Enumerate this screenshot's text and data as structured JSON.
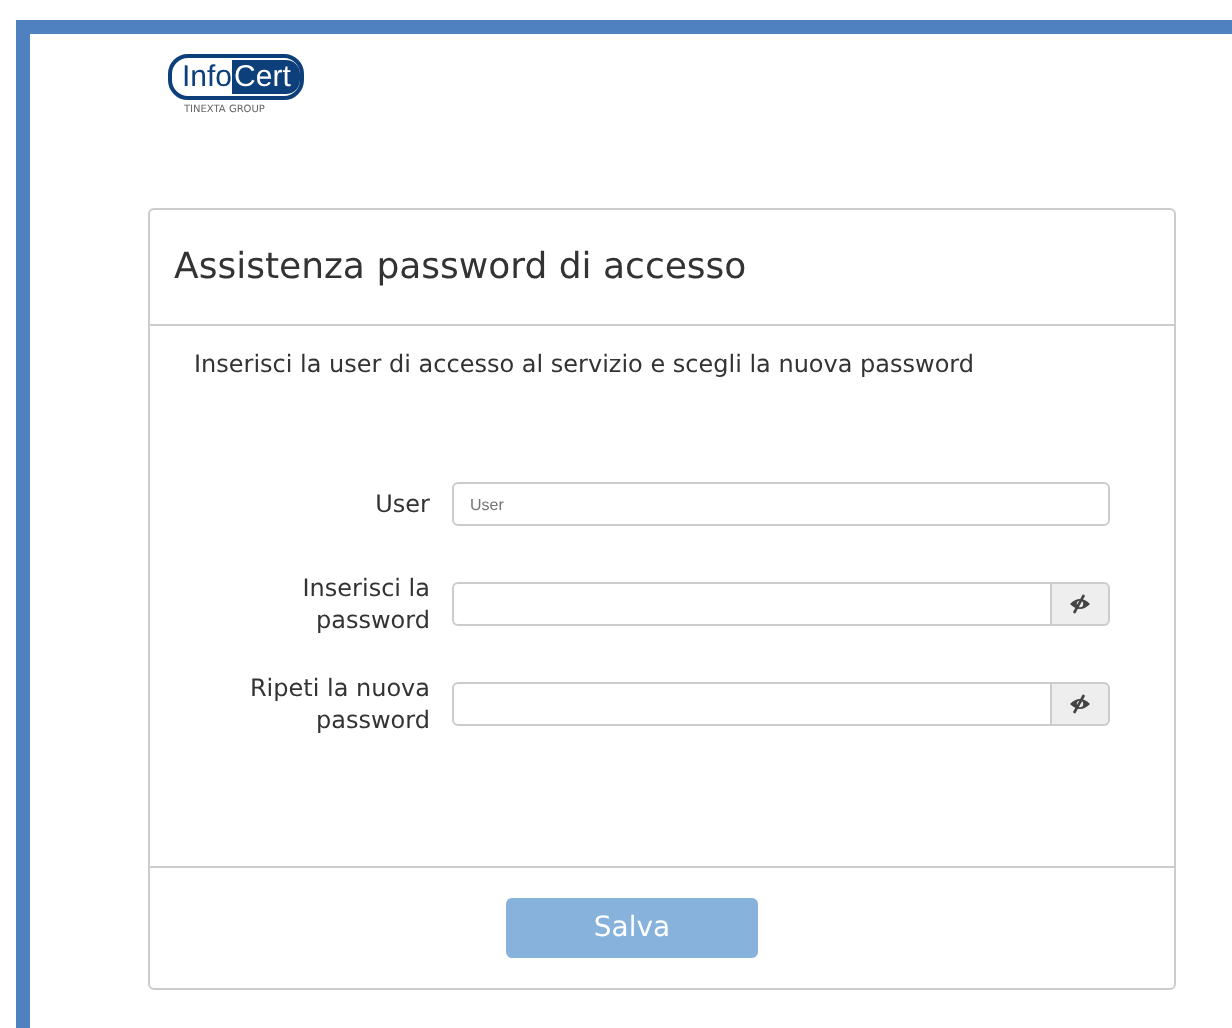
{
  "logo": {
    "brand_left": "Info",
    "brand_right": "Cert",
    "tagline": "TINEXTA GROUP"
  },
  "card": {
    "title": "Assistenza password di accesso",
    "intro": "Inserisci la user di accesso al servizio e scegli la nuova password",
    "fields": [
      {
        "kind": "text",
        "label": "User",
        "placeholder": "User"
      },
      {
        "kind": "password",
        "label": "Inserisci la password"
      },
      {
        "kind": "password",
        "label": "Ripeti la nuova password"
      }
    ],
    "save_button": {
      "label": "Salva",
      "disabled": true
    }
  }
}
